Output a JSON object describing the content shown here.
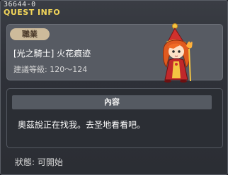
{
  "window": {
    "quest_id": "36644-0",
    "title": "QUEST INFO"
  },
  "job": {
    "tag": "職業",
    "quest_name": "[光之騎士] 火花痕迹",
    "level_requirement": "建議等級: 120〜124"
  },
  "content": {
    "header": "內容",
    "description": "奧茲說正在找我。去圣地看看吧。"
  },
  "status": {
    "text": "狀態:  可開始"
  },
  "colors": {
    "title": "#f3d65a",
    "job_tag_bg": "#cdbb9b",
    "panel_bg": "#575b63"
  },
  "icons": {
    "character": "npc-fire-mage-portrait"
  }
}
